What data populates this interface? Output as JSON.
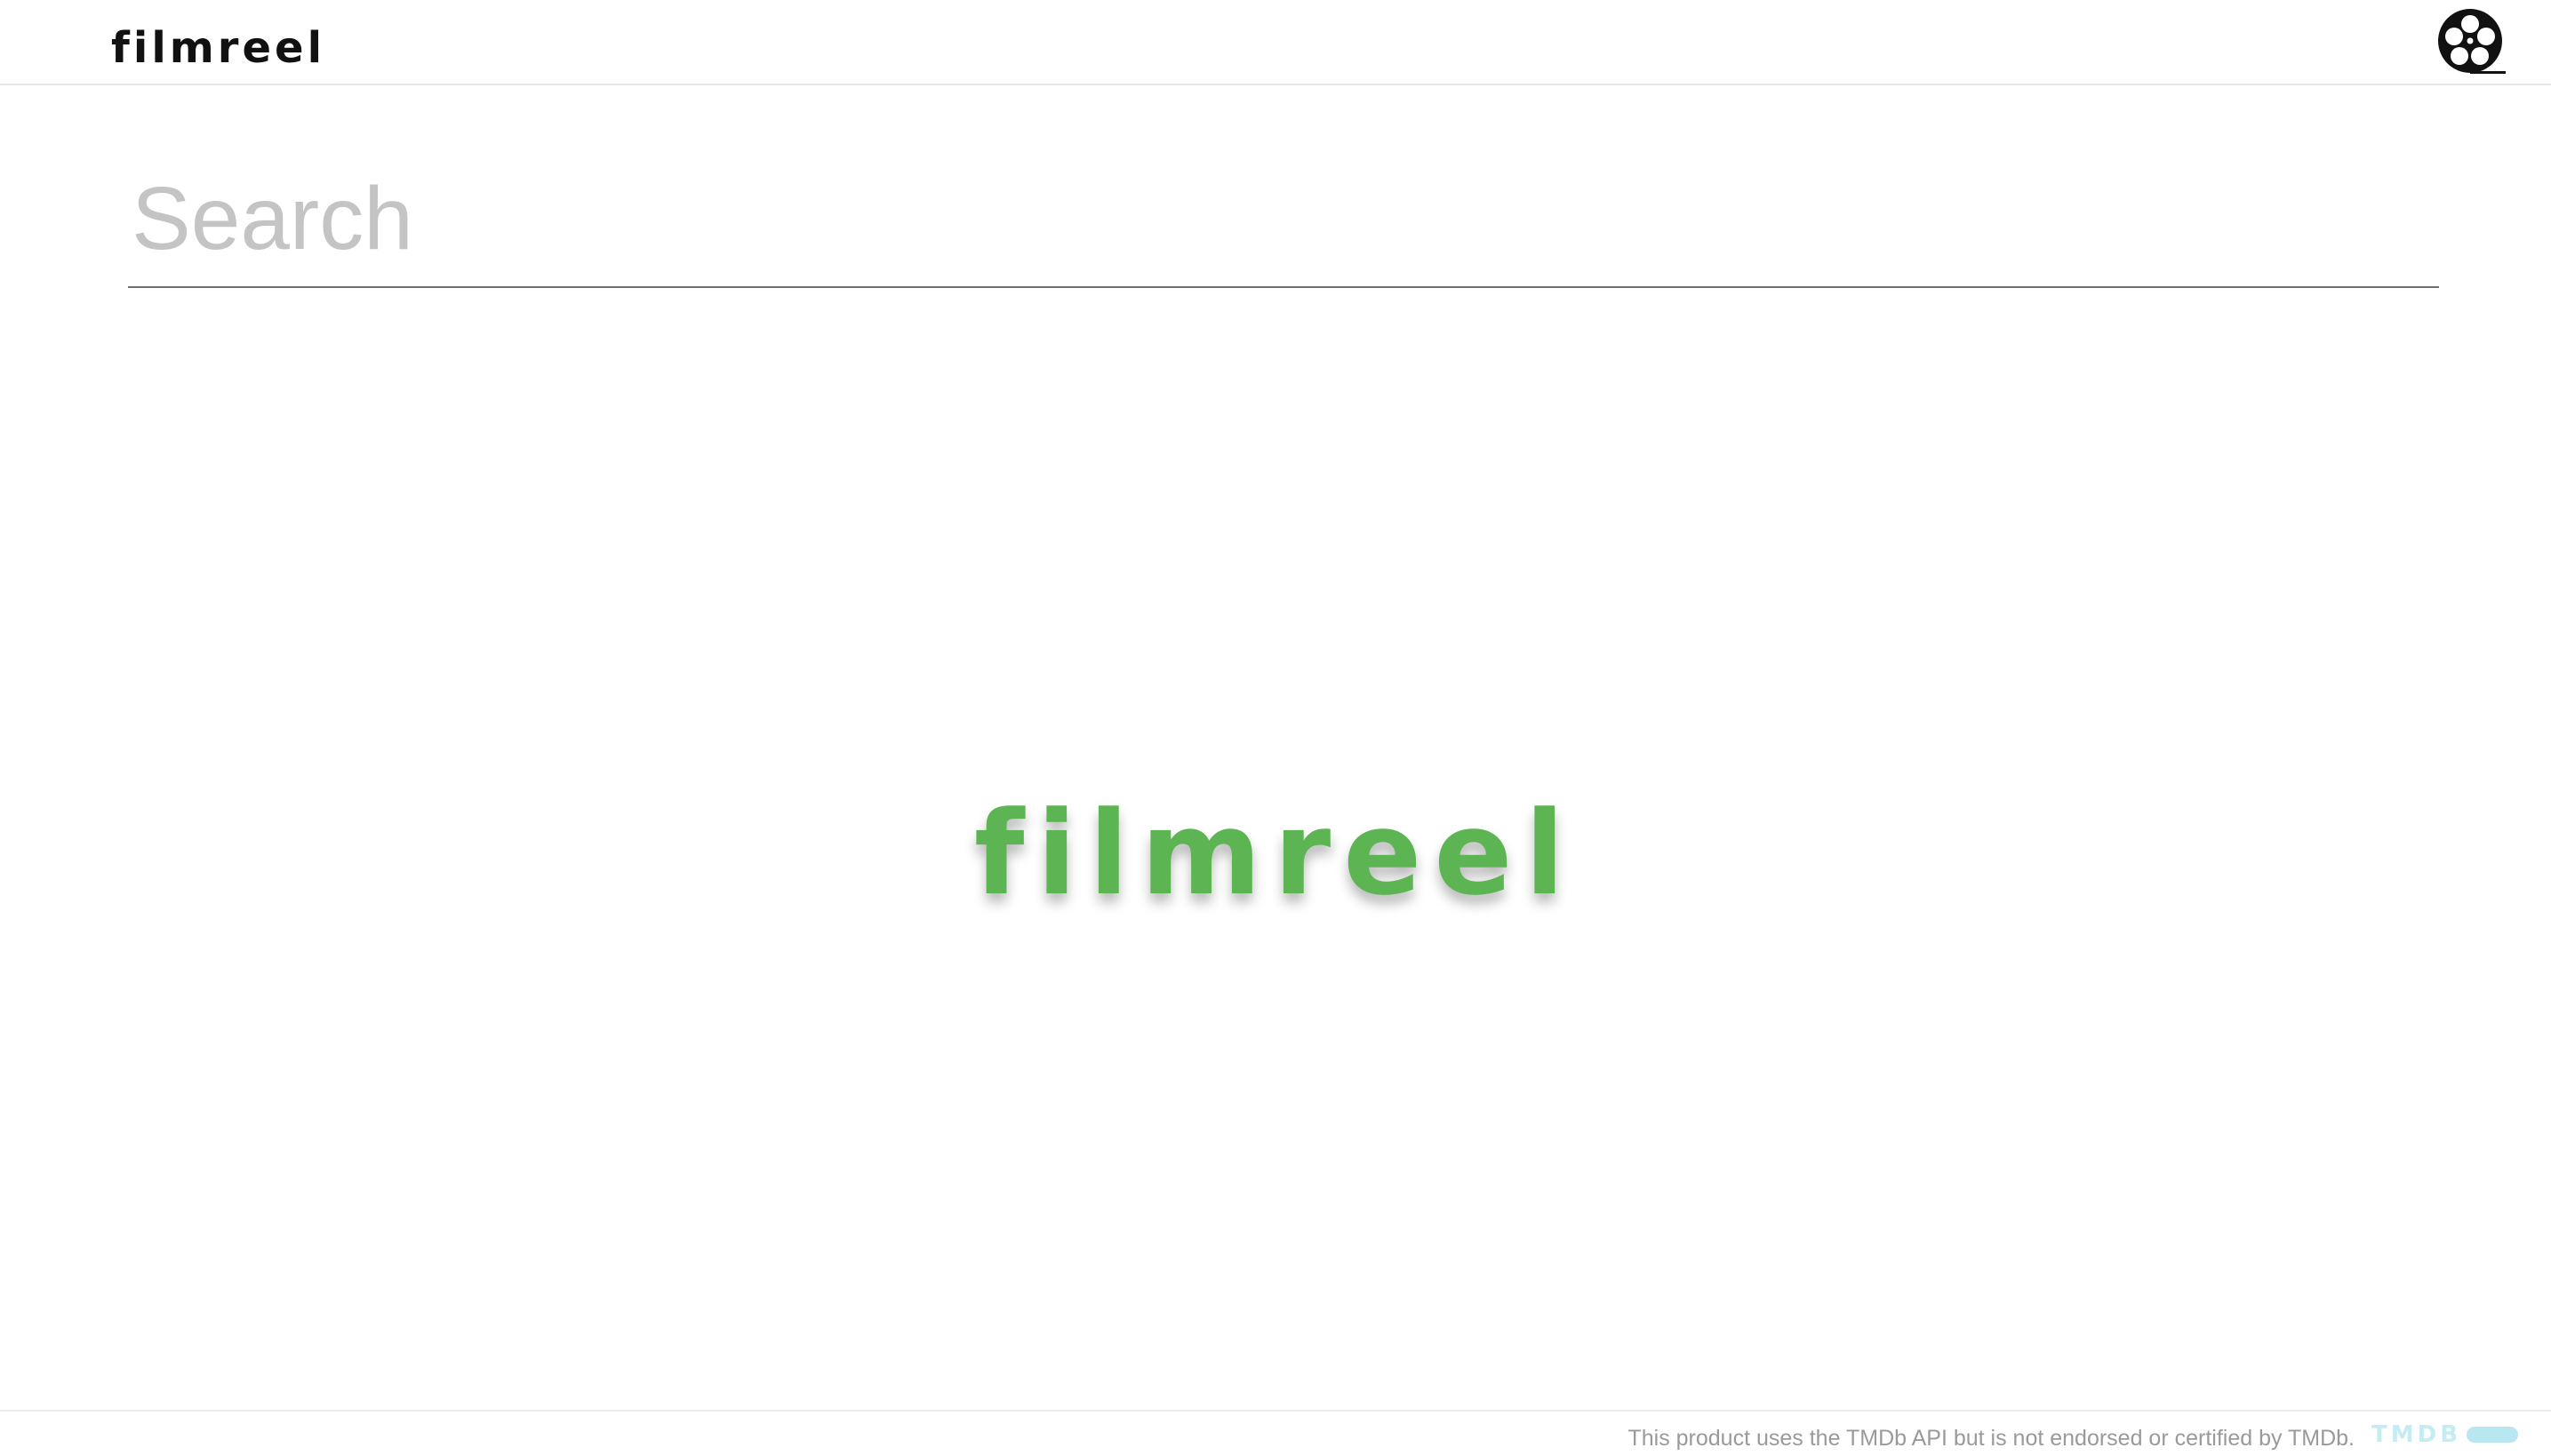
{
  "header": {
    "brand": "filmreel",
    "reel_icon": "film-reel-icon"
  },
  "search": {
    "placeholder": "Search",
    "value": ""
  },
  "hero": {
    "logo_text": "filmreel",
    "color": "#5cb552"
  },
  "footer": {
    "disclaimer": "This product uses the TMDb API but is not endorsed or certified by TMDb.",
    "tmdb_logo_text": "TMDB"
  }
}
